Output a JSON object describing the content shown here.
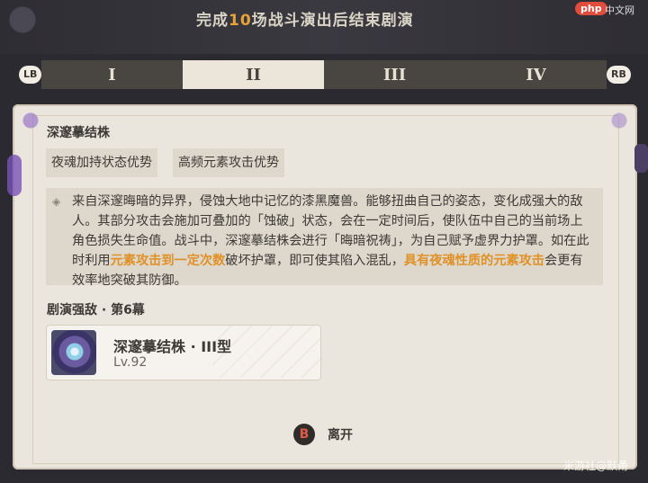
{
  "header": {
    "banner_pre": "完成",
    "banner_count": "10",
    "banner_post": "场战斗演出后结束剧演",
    "php_badge": "php",
    "php_text": "中文网"
  },
  "tabs": [
    {
      "label": "I",
      "active": false
    },
    {
      "label": "II",
      "active": true
    },
    {
      "label": "III",
      "active": false
    },
    {
      "label": "IV",
      "active": false
    }
  ],
  "shoulder_left": "LB",
  "shoulder_right": "RB",
  "boss": {
    "name": "深邃摹结株",
    "tags": [
      "夜魂加持状态优势",
      "高频元素攻击优势"
    ],
    "desc_1": "来自深邃晦暗的异界，侵蚀大地中记忆的漆黑魔兽。能够扭曲自己的姿态，变化成强大的敌人。其部分攻击会施加可叠加的「蚀破」状态，会在一定时间后，使队伍中自己的当前场上角色损失生命值。战斗中，深邃摹结株会进行「晦暗祝祷」，为自己赋予虚界力护罩。如在此时利用",
    "desc_hl_1": "元素攻击到一定次数",
    "desc_2": "破坏护罩，即可使其陷入混乱，",
    "desc_hl_2": "具有夜魂性质的元素攻击",
    "desc_3": "会更有效率地突破其防御。"
  },
  "section_title": "剧演强敌 · 第6幕",
  "enemy": {
    "name": "深邃摹结株 · III型",
    "level": "Lv.92"
  },
  "leave": {
    "key": "B",
    "label": "离开"
  },
  "watermark": "米游社@默甬",
  "colors": {
    "highlight": "#e09228",
    "accent_banner": "#e8a23a",
    "panel_bg": "#ebe6dd",
    "tab_bar": "#494540",
    "tab_active": "#ece6da"
  }
}
